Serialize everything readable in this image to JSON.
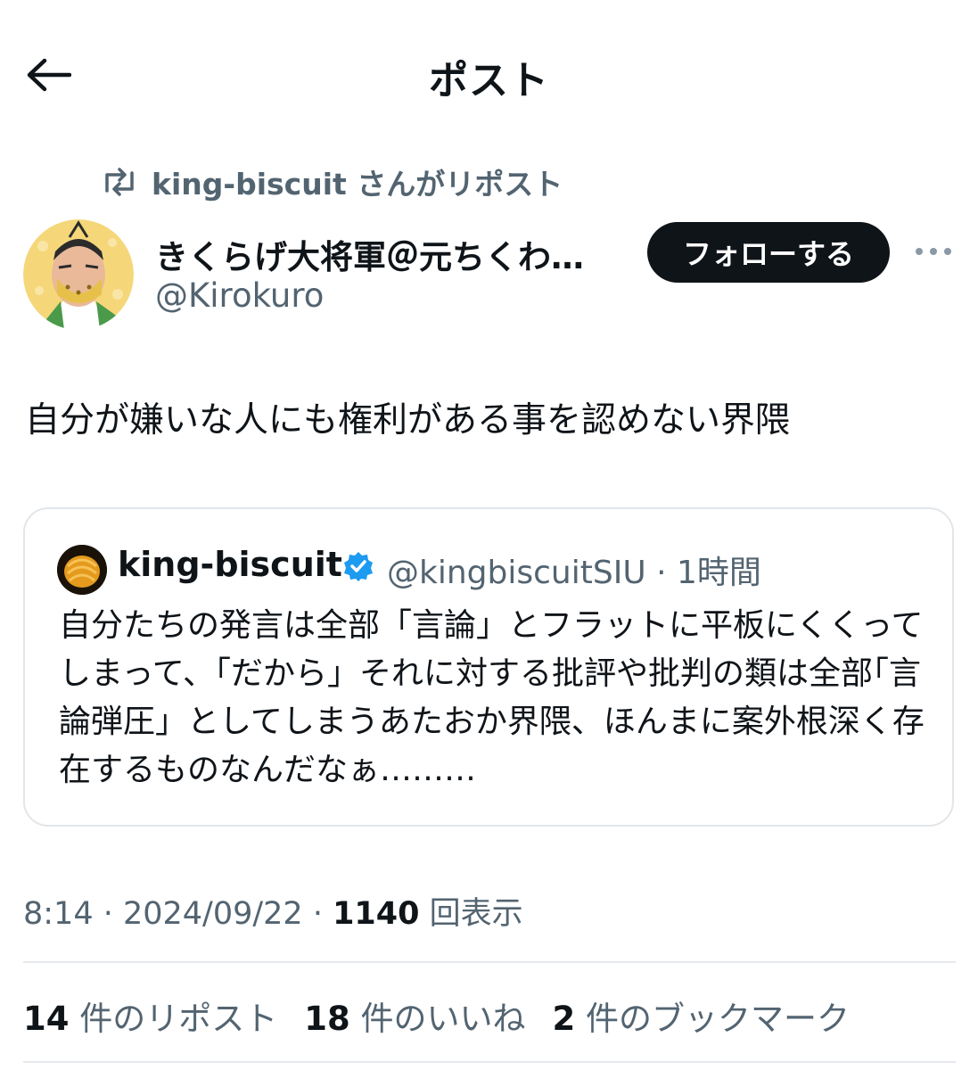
{
  "header": {
    "title": "ポスト",
    "back_icon": "arrow-left-icon"
  },
  "repost": {
    "icon": "repost-icon",
    "text": "king-biscuit さんがリポスト"
  },
  "author": {
    "name": "きくらげ大将軍＠元ちくわ…",
    "handle": "@Kirokuro",
    "follow_label": "フォローする",
    "more_icon": "more-dots-icon"
  },
  "post": {
    "text": "自分が嫌いな人にも権利がある事を認めない界隈"
  },
  "quote": {
    "name": "king-biscuit",
    "verified_icon": "verified-badge-icon",
    "handle_time": "@kingbiscuitSIU · 1時間",
    "text": "自分たちの発言は全部「言論」とフラットに平板にくくってしまって、「だから」それに対する批評や批判の類は全部｢言論弾圧」としてしまうあたおか界隈、ほんまに案外根深く存在するものなんだなぁ………"
  },
  "meta": {
    "time_date": "8:14 · 2024/09/22 · ",
    "views_count": "1140",
    "views_label": " 回表示"
  },
  "stats": {
    "reposts_count": "14",
    "reposts_label": " 件のリポスト",
    "likes_count": "18",
    "likes_label": " 件のいいね",
    "bookmarks_count": "2",
    "bookmarks_label": " 件のブックマーク"
  },
  "colors": {
    "text": "#0f1419",
    "secondary": "#536471",
    "verified": "#1d9bf0",
    "border": "#e1e6ea"
  }
}
